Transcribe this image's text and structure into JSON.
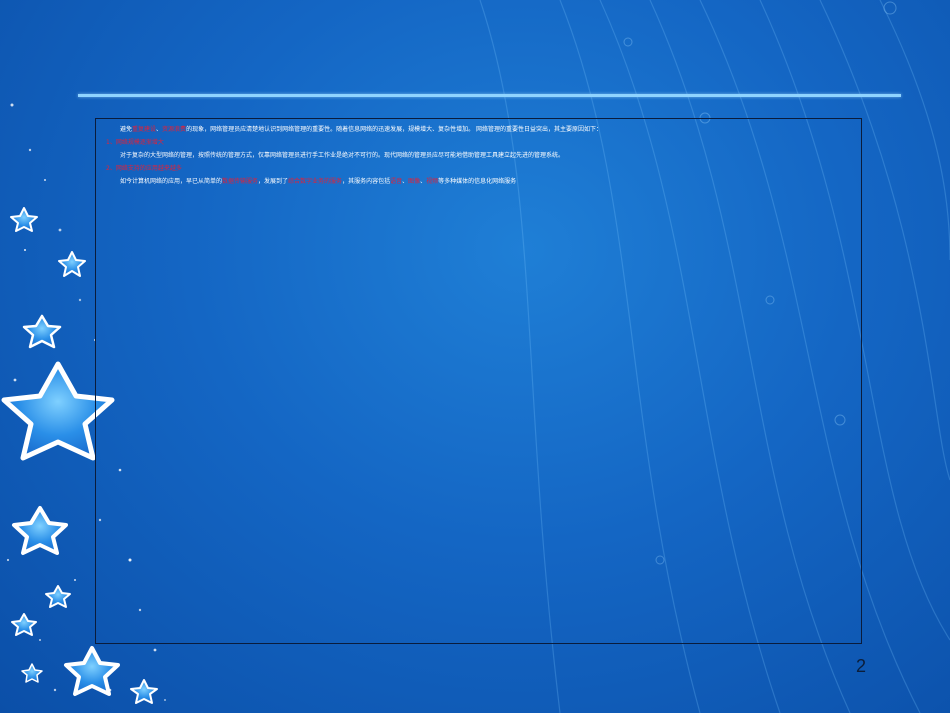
{
  "content": {
    "line1": {
      "a": "避免",
      "b": "重复建设",
      "c": "、",
      "d": "资源浪费",
      "e": "的现象，网络管理员应清楚地认识到网络管理的重要性。随着信息网络的迅速发展，规模增大、复杂性增加。 网络管理的重要性日益突出，其主要原因如下："
    },
    "item1_title": "1、网络规模逐渐增大",
    "item1_body": "对于复杂的大型网络的管理，按照传统的管理方式，仅靠网络管理员进行手工作业是绝对不可行的。现代网络的管理员应尽可能地借助管理工具建立起先进的管理系统。",
    "item2_title": "2、网络支持的应用越来越多",
    "line6": {
      "a": "如今计算机网络的应用，早已从简单的",
      "b": "数据传输服务",
      "c": "，发展到了",
      "d": "综合数字业务的服务",
      "e": "，其服务内容包括",
      "f": "语音",
      "g": "、",
      "h": "图像",
      "i": "、",
      "j": "视频",
      "k": "等多种媒体的信息化网络服务"
    }
  },
  "page_number": "2"
}
